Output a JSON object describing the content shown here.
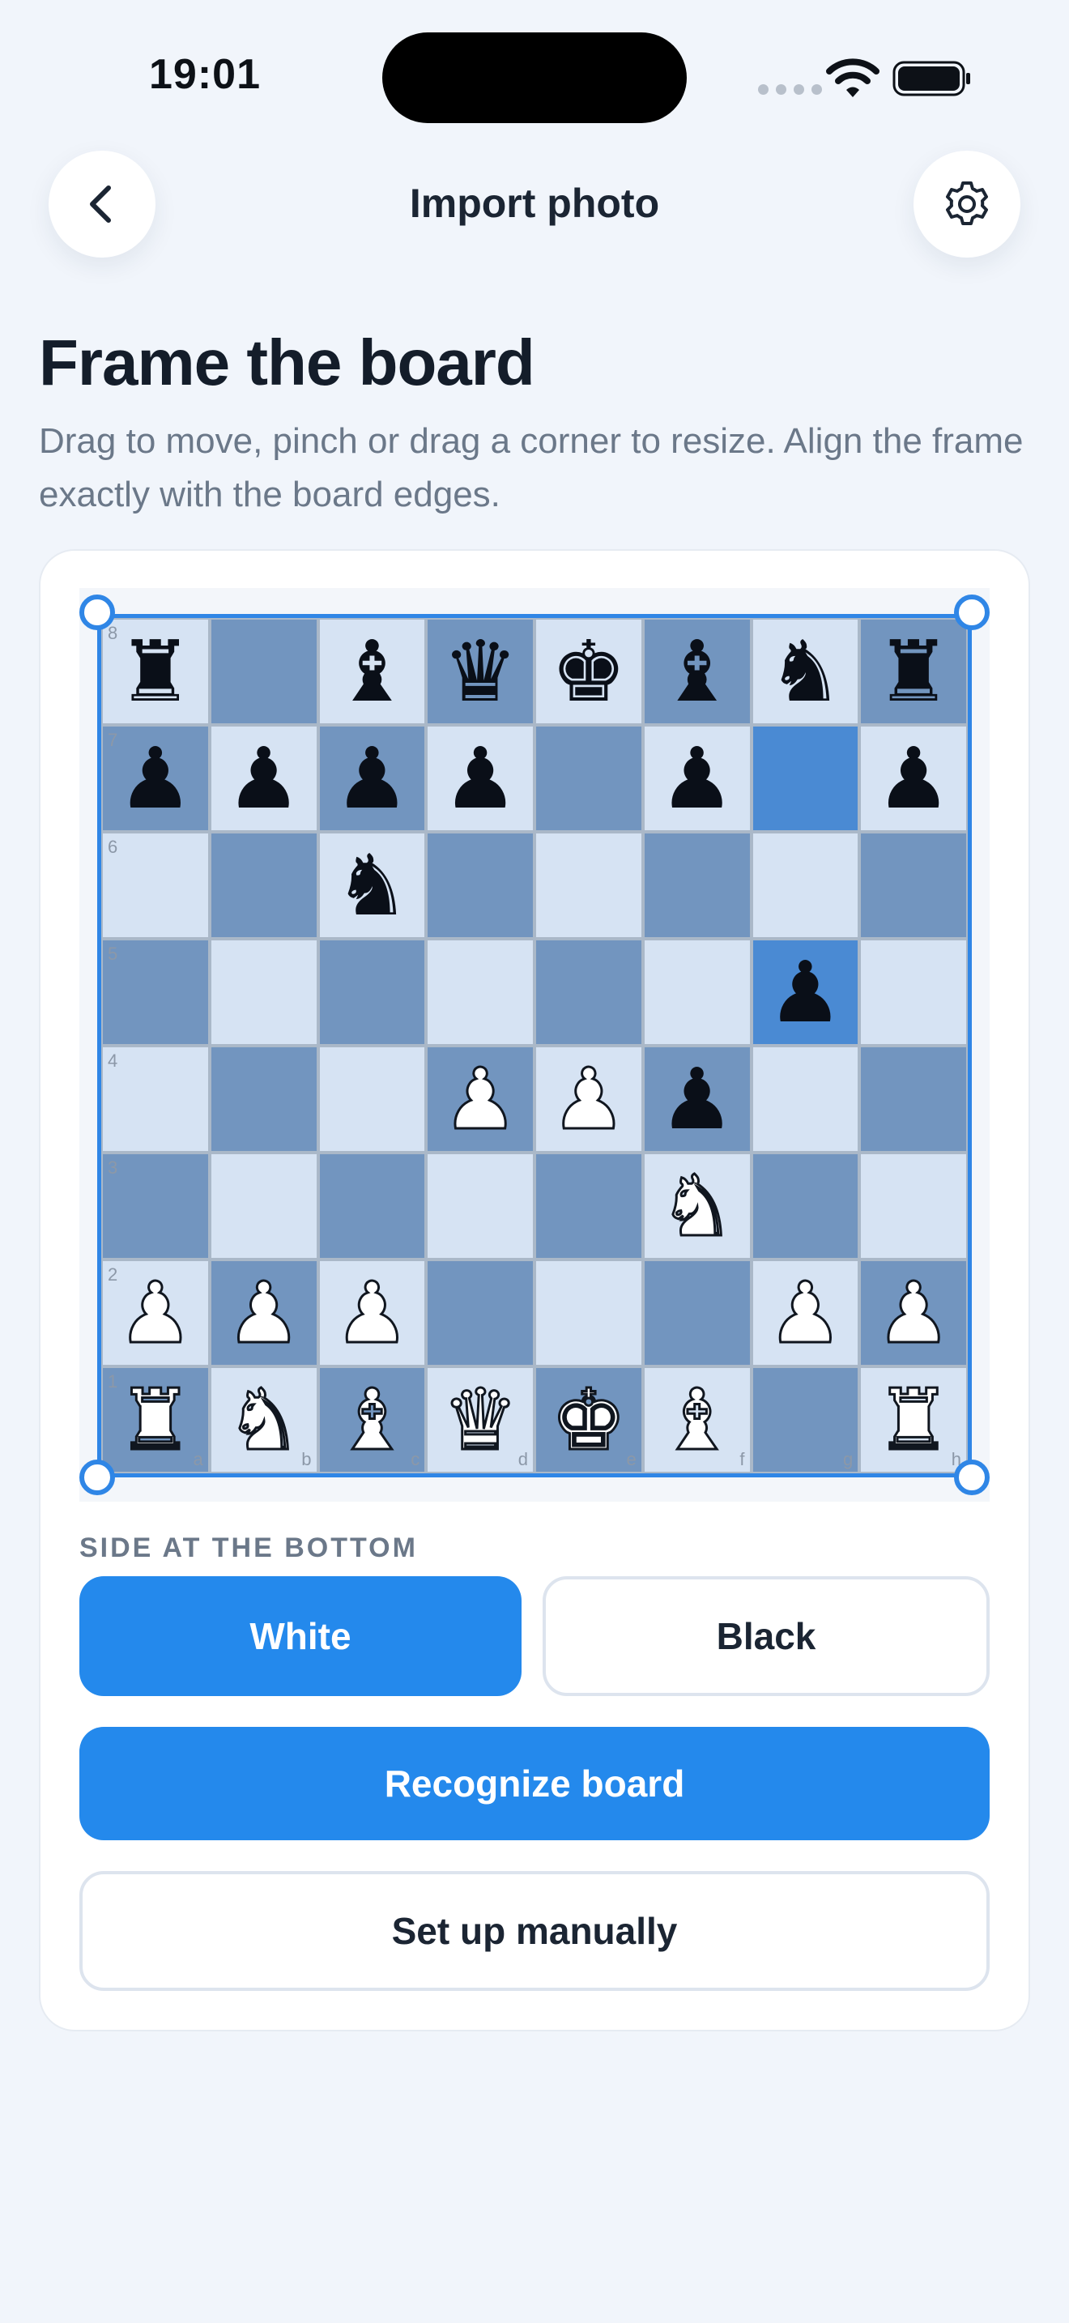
{
  "status_bar": {
    "time": "19:01"
  },
  "header": {
    "title": "Import photo"
  },
  "page": {
    "title": "Frame the board",
    "subtitle": "Drag to move, pinch or drag a corner to resize. Align the frame exactly with the board edges."
  },
  "board": {
    "ranks": [
      "8",
      "7",
      "6",
      "5",
      "4",
      "3",
      "2",
      "1"
    ],
    "files": [
      "a",
      "b",
      "c",
      "d",
      "e",
      "f",
      "g",
      "h"
    ],
    "position": [
      [
        "br",
        "",
        "bb",
        "bq",
        "bk",
        "bb",
        "bn",
        "br"
      ],
      [
        "bp",
        "bp",
        "bp",
        "bp",
        "",
        "bp",
        "",
        "bp"
      ],
      [
        "",
        "",
        "bn",
        "",
        "",
        "",
        "",
        ""
      ],
      [
        "",
        "",
        "",
        "",
        "",
        "",
        "bp",
        ""
      ],
      [
        "",
        "",
        "",
        "wp",
        "wp",
        "bp",
        "",
        ""
      ],
      [
        "",
        "",
        "",
        "",
        "",
        "wn",
        "",
        ""
      ],
      [
        "wp",
        "wp",
        "wp",
        "",
        "",
        "",
        "wp",
        "wp"
      ],
      [
        "wr",
        "wn",
        "wb",
        "wq",
        "wk",
        "wb",
        "",
        "wr"
      ]
    ],
    "highlighted_squares": [
      "g7",
      "g5"
    ]
  },
  "side_selector": {
    "label": "SIDE AT THE BOTTOM",
    "options": [
      "White",
      "Black"
    ],
    "selected": "White"
  },
  "actions": {
    "recognize": "Recognize board",
    "manual": "Set up manually"
  }
}
